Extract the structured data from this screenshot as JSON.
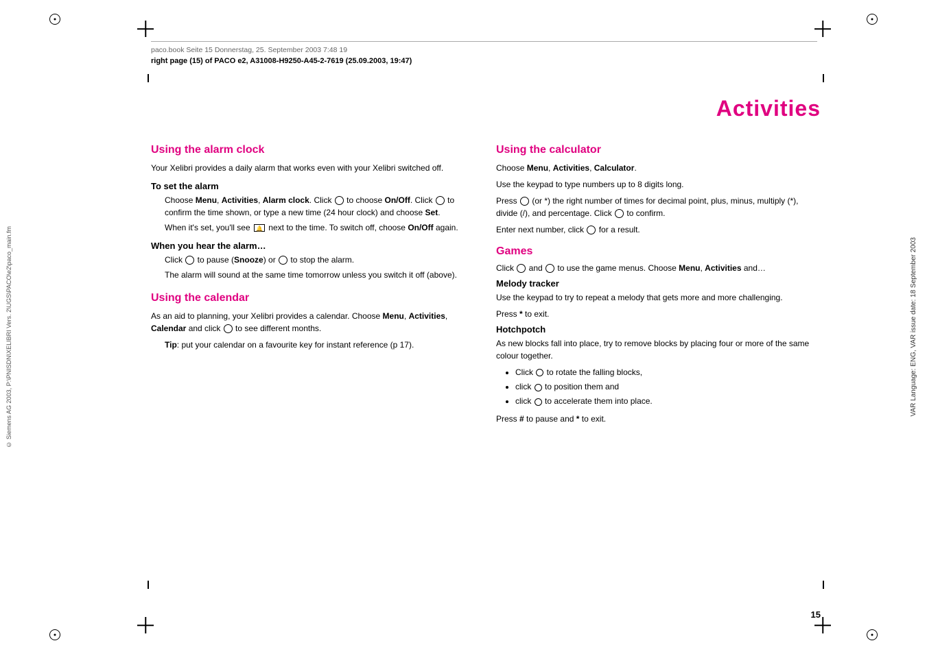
{
  "page": {
    "number": "15",
    "file_info": "paco.book  Seite 15  Donnerstag, 25. September 2003  7:48 19",
    "page_info_label": "right page (15)",
    "page_info_detail": "of PACO e2, A31008-H9250-A45-2-7619 (25.09.2003, 19:47)"
  },
  "right_sidebar": {
    "var_label": "VAR Language: ENG, VAR issue date: 18 September 2003"
  },
  "left_sidebar": {
    "copyright": "© Siemens AG 2003, P:\\PNISDN\\XELIBRI Vers. 2\\UGS\\PACO\\e2\\paco_main.fm"
  },
  "page_title": "Activities",
  "sections": {
    "alarm_clock": {
      "heading": "Using the alarm clock",
      "intro": "Your Xelibri provides a daily alarm that works even with your Xelibri switched off.",
      "set_alarm_heading": "To set the alarm",
      "set_alarm_text1": "Choose Menu, Activities, Alarm clock. Click  to choose On/Off. Click  to confirm the time shown, or type a new time (24 hour clock) and choose Set.",
      "set_alarm_text2": "When it's set, you'll see  next to the time. To switch off, choose On/Off again.",
      "when_hear_heading": "When you hear the alarm…",
      "when_hear_text1": "Click  to pause (Snooze) or  to stop the alarm.",
      "when_hear_text2": "The alarm will sound at the same time tomorrow unless you switch it off (above)."
    },
    "calendar": {
      "heading": "Using the calendar",
      "intro": "As an aid to planning, your Xelibri provides a calendar. Choose Menu, Activities, Calendar and click  to see different months.",
      "tip": "Tip: put your calendar on a favourite key for instant reference (p 17)."
    },
    "calculator": {
      "heading": "Using the calculator",
      "text1": "Choose Menu, Activities, Calculator.",
      "text2": "Use the keypad to type numbers up to 8 digits long.",
      "text3": "Press  (or *) the right number of times for decimal point, plus, minus, multiply (*), divide (/), and percentage. Click  to confirm.",
      "text4": "Enter next number, click  for a result."
    },
    "games": {
      "heading": "Games",
      "intro": "Click  and  to use the game menus. Choose Menu, Activities and…",
      "melody_tracker": {
        "heading": "Melody tracker",
        "text1": "Use the keypad to try to repeat a melody that gets more and more challenging.",
        "text2": "Press * to exit."
      },
      "hotchpotch": {
        "heading": "Hotchpotch",
        "text1": "As new blocks fall into place, try to remove blocks by placing four or more of the same colour together.",
        "bullets": [
          "Click  to rotate the falling blocks,",
          "click  to position them and",
          "click  to accelerate them into place."
        ],
        "text2": "Press # to pause and * to exit."
      }
    }
  }
}
